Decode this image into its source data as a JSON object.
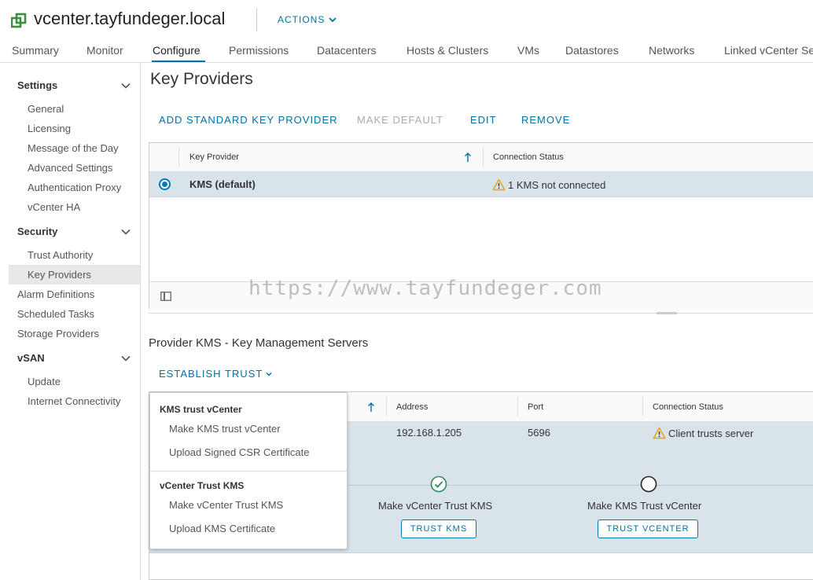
{
  "header": {
    "title": "vcenter.tayfundeger.local",
    "actions_label": "ACTIONS",
    "brand_color": "#3e8e41"
  },
  "tabs": [
    "Summary",
    "Monitor",
    "Configure",
    "Permissions",
    "Datacenters",
    "Hosts & Clusters",
    "VMs",
    "Datastores",
    "Networks",
    "Linked vCenter Server Systems"
  ],
  "active_tab": "Configure",
  "sidebar": {
    "settings": {
      "title": "Settings",
      "items": [
        "General",
        "Licensing",
        "Message of the Day",
        "Advanced Settings",
        "Authentication Proxy",
        "vCenter HA"
      ]
    },
    "security": {
      "title": "Security",
      "items": [
        "Trust Authority",
        "Key Providers"
      ]
    },
    "top_items": [
      "Alarm Definitions",
      "Scheduled Tasks",
      "Storage Providers"
    ],
    "vsan": {
      "title": "vSAN",
      "items": [
        "Update",
        "Internet Connectivity"
      ]
    },
    "selected": "Key Providers"
  },
  "main": {
    "title": "Key Providers",
    "toolbar": {
      "add": "ADD STANDARD KEY PROVIDER",
      "make_default": "MAKE DEFAULT",
      "edit": "EDIT",
      "remove": "REMOVE"
    },
    "grid1": {
      "columns": [
        "Key Provider",
        "Connection Status"
      ],
      "rows": [
        {
          "name": "KMS (default)",
          "status": "1 KMS not connected",
          "selected": true
        }
      ]
    },
    "section2_title": "Provider KMS - Key Management Servers",
    "establish_trust": "ESTABLISH TRUST",
    "grid2": {
      "columns": [
        "Address",
        "Port",
        "Connection Status"
      ],
      "row": {
        "address": "192.168.1.205",
        "port": "5696",
        "status": "Client trusts server"
      },
      "steps": [
        {
          "label": "Make vCenter Trust KMS",
          "button": "TRUST KMS",
          "done": true
        },
        {
          "label": "Make KMS Trust vCenter",
          "button": "TRUST VCENTER",
          "done": false
        }
      ]
    },
    "dropdown": {
      "group1": {
        "header": "KMS trust vCenter",
        "items": [
          "Make KMS trust vCenter",
          "Upload Signed CSR Certificate"
        ]
      },
      "group2": {
        "header": "vCenter Trust KMS",
        "items": [
          "Make vCenter Trust KMS",
          "Upload KMS Certificate"
        ]
      }
    }
  },
  "watermark": "https://www.tayfundeger.com",
  "colors": {
    "accent": "#0072a3",
    "selected_row": "#d9e4ea",
    "warning": "#e8a317",
    "success": "#2e8b57"
  }
}
